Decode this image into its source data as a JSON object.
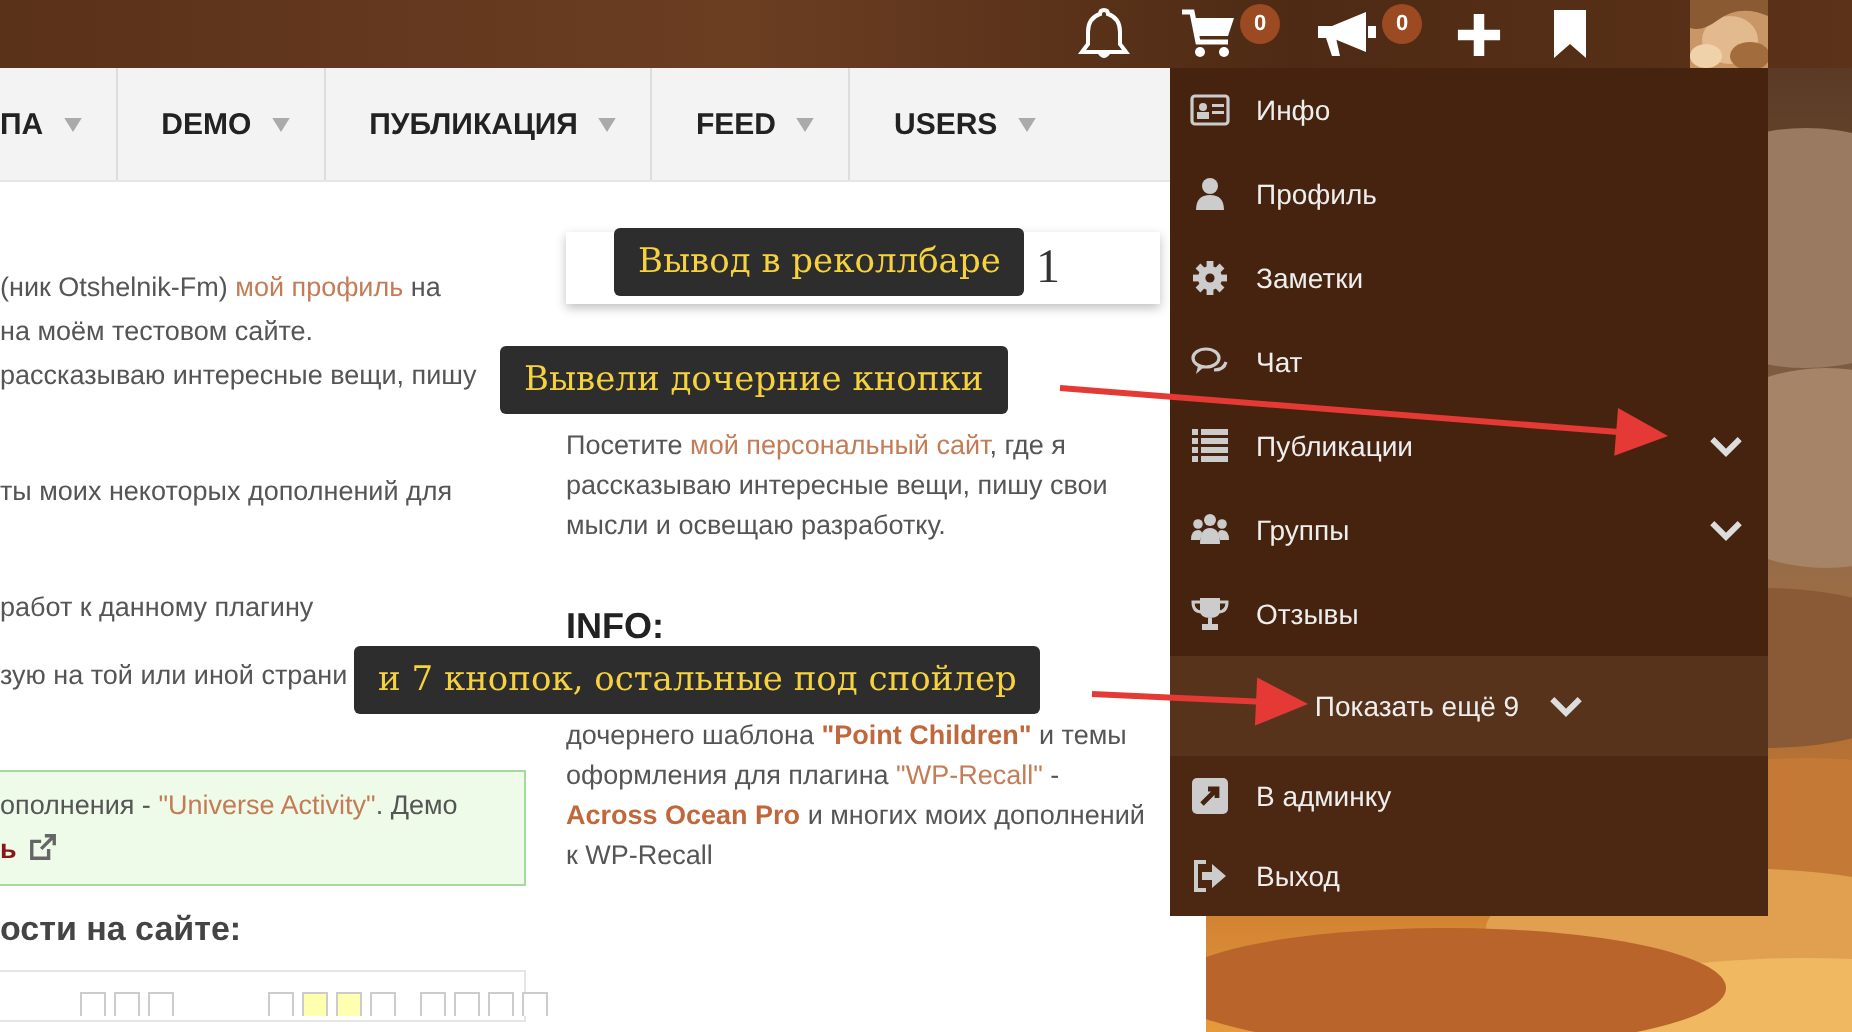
{
  "topbar": {
    "icons": [
      {
        "kind": "bell"
      },
      {
        "kind": "cart",
        "badge": "0"
      },
      {
        "kind": "megaphone",
        "badge": "0"
      },
      {
        "kind": "plus"
      },
      {
        "kind": "bookmark"
      }
    ]
  },
  "nav": [
    {
      "label": "ПА"
    },
    {
      "label": "DEMO"
    },
    {
      "label": "ПУБЛИКАЦИЯ"
    },
    {
      "label": "FEED"
    },
    {
      "label": "USERS"
    }
  ],
  "left_column": {
    "paragraphs": [
      {
        "lines": [
          [
            {
              "text": "(ник Otshelnik-Fm) ",
              "kind": "text"
            },
            {
              "text": "мой профиль",
              "kind": "link"
            },
            {
              "text": " на",
              "kind": "text"
            }
          ],
          [
            {
              "text": "на моём тестовом сайте.",
              "kind": "text"
            }
          ],
          [
            {
              "text": "рассказываю интересные вещи, пишу",
              "kind": "text"
            }
          ]
        ]
      },
      {
        "lines": [
          [
            {
              "text": "ты моих некоторых дополнений для",
              "kind": "text"
            }
          ]
        ]
      },
      {
        "lines": [
          [
            {
              "text": "работ к данному плагину",
              "kind": "text"
            }
          ]
        ]
      },
      {
        "lines": [
          [
            {
              "text": "зую на той или иной страни",
              "kind": "text"
            }
          ]
        ]
      }
    ],
    "note": {
      "lines": [
        [
          {
            "text": "ополнения - ",
            "kind": "text"
          },
          {
            "text": "\"Universe Activity\"",
            "kind": "link"
          },
          {
            "text": ". Демо",
            "kind": "text"
          }
        ],
        [
          {
            "text": "ь",
            "kind": "strong"
          }
        ]
      ]
    },
    "heading": "ости на сайте:"
  },
  "right_column": {
    "card": {
      "text": "1"
    },
    "paragraph": {
      "lines": [
        [
          {
            "text": "Посетите ",
            "kind": "text"
          },
          {
            "text": "мой персональный сайт",
            "kind": "link"
          },
          {
            "text": ", где я",
            "kind": "text"
          }
        ],
        [
          {
            "text": "рассказываю интересные вещи, пишу свои",
            "kind": "text"
          }
        ],
        [
          {
            "text": "мысли и освещаю разработку.",
            "kind": "text"
          }
        ]
      ]
    },
    "info_heading": "INFO:",
    "info_paragraph": {
      "lines": [
        [
          {
            "text": "дочернего шаблона ",
            "kind": "text"
          },
          {
            "text": "\"Point Children\"",
            "kind": "bold_link"
          },
          {
            "text": " и темы",
            "kind": "text"
          }
        ],
        [
          {
            "text": "оформления для плагина ",
            "kind": "text"
          },
          {
            "text": "\"WP-Recall\"",
            "kind": "link"
          },
          {
            "text": " -",
            "kind": "text"
          }
        ],
        [
          {
            "text": "Across Ocean Pro",
            "kind": "bold_link"
          },
          {
            "text": " и многих моих дополнений",
            "kind": "text"
          }
        ],
        [
          {
            "text": "к WP-Recall",
            "kind": "text"
          }
        ]
      ]
    }
  },
  "user_menu": {
    "items": [
      {
        "label": "Инфо",
        "kind": "link"
      },
      {
        "label": "Профиль",
        "kind": "link"
      },
      {
        "label": "Заметки",
        "kind": "link"
      },
      {
        "label": "Чат",
        "kind": "link"
      },
      {
        "label": "Публикации",
        "kind": "submenu",
        "expanded": false
      },
      {
        "label": "Группы",
        "kind": "submenu",
        "expanded": false
      },
      {
        "label": "Отзывы",
        "kind": "link"
      }
    ],
    "more": {
      "label": "Показать ещё 9",
      "expanded": false
    },
    "footer_items": [
      {
        "label": "В админку"
      },
      {
        "label": "Выход"
      }
    ]
  },
  "annotations": [
    {
      "text": "Вывод в реколлбаре",
      "arrow": false
    },
    {
      "text": "Вывели дочерние кнопки",
      "arrow": true
    },
    {
      "text": "и 7 кнопок, остальные под спойлер",
      "arrow": true
    }
  ]
}
